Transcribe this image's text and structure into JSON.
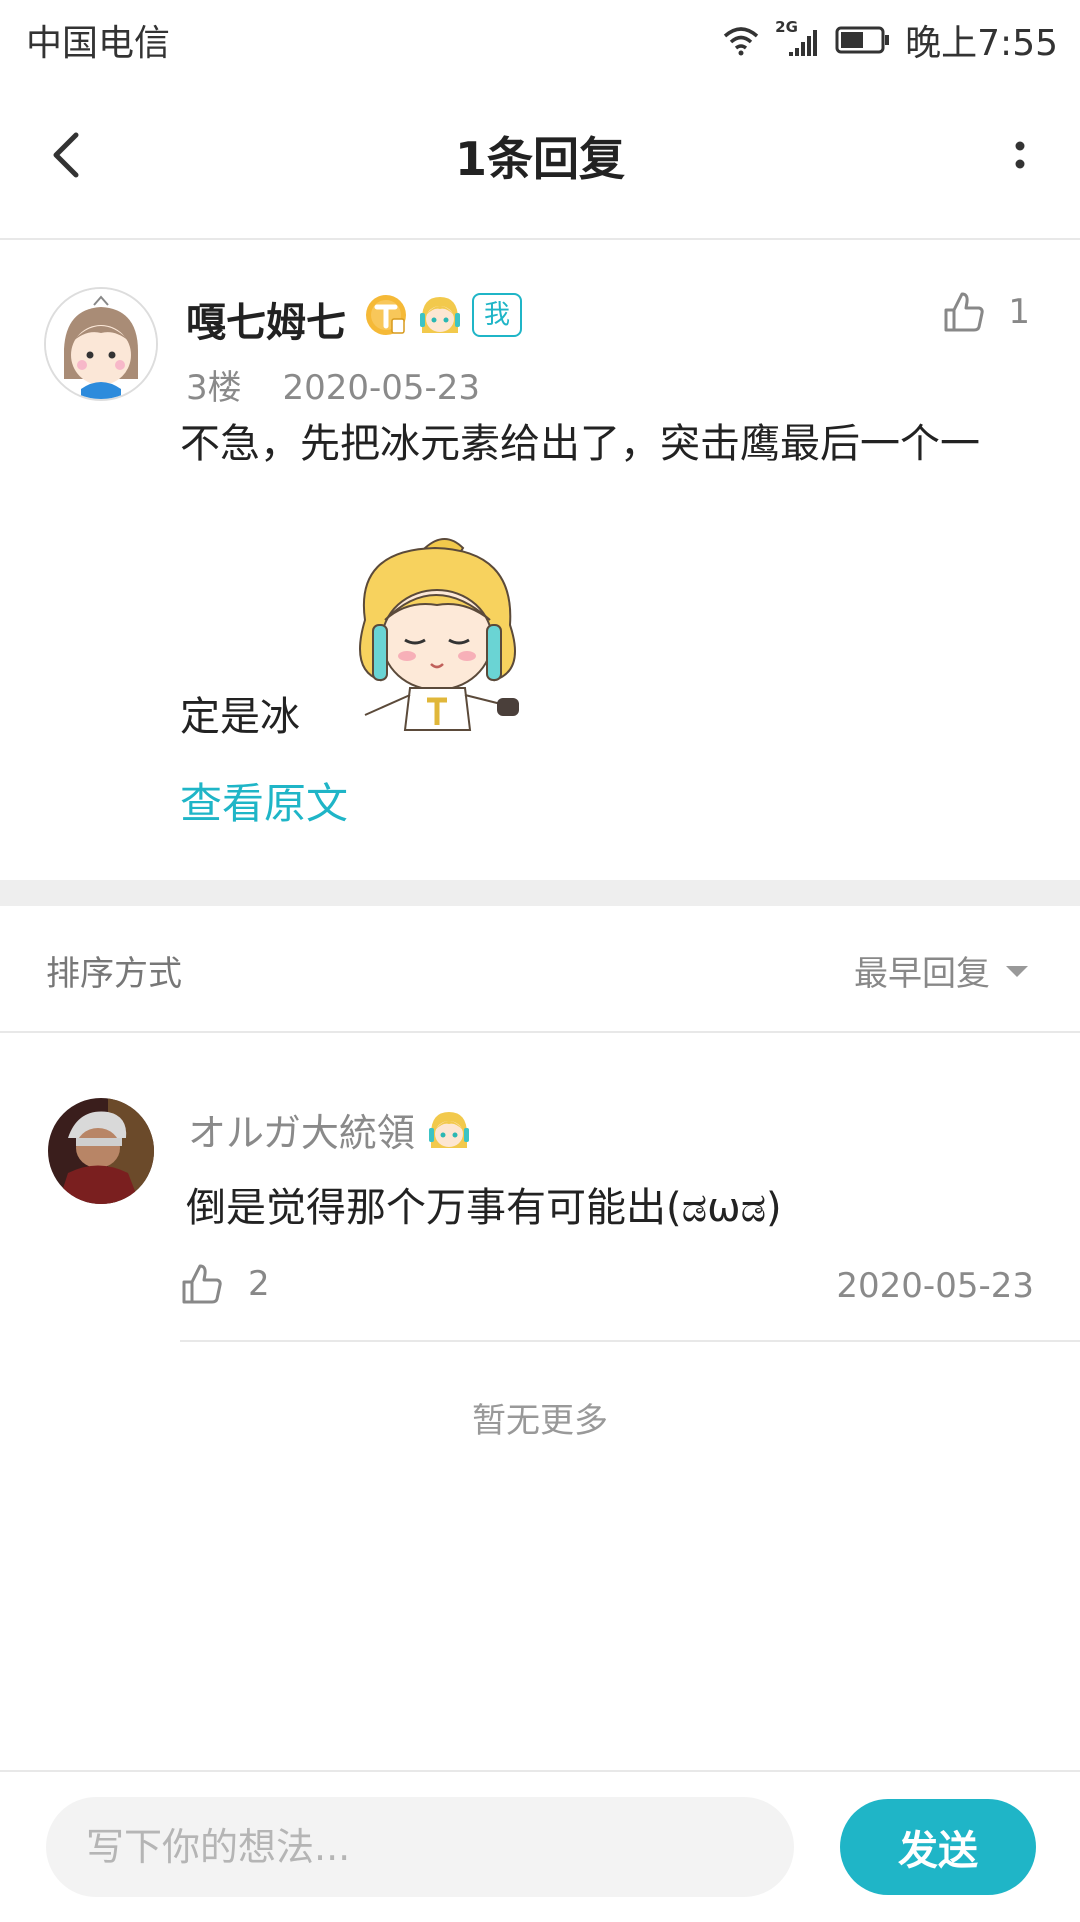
{
  "status_bar": {
    "carrier": "中国电信",
    "network": "2G",
    "time": "晚上7:55"
  },
  "nav": {
    "title": "1条回复"
  },
  "post": {
    "username": "嘎七姆七",
    "me_badge": "我",
    "likes": "1",
    "floor": "3楼",
    "date": "2020-05-23",
    "text_line1": "不急，先把冰元素给出了，突击鹰最后一个一",
    "text_line2": "定是冰",
    "view_original": "查看原文"
  },
  "sort": {
    "label": "排序方式",
    "selected": "最早回复"
  },
  "replies": [
    {
      "username": "オルガ大統領",
      "text": "倒是觉得那个万事有可能出(ಡωಡ)",
      "likes": "2",
      "date": "2020-05-23"
    }
  ],
  "no_more": "暂无更多",
  "composer": {
    "placeholder": "写下你的想法...",
    "send_label": "发送"
  },
  "colors": {
    "accent": "#1fb5c7",
    "divider": "#e8e8e8",
    "muted_text": "#8a8a8a"
  }
}
